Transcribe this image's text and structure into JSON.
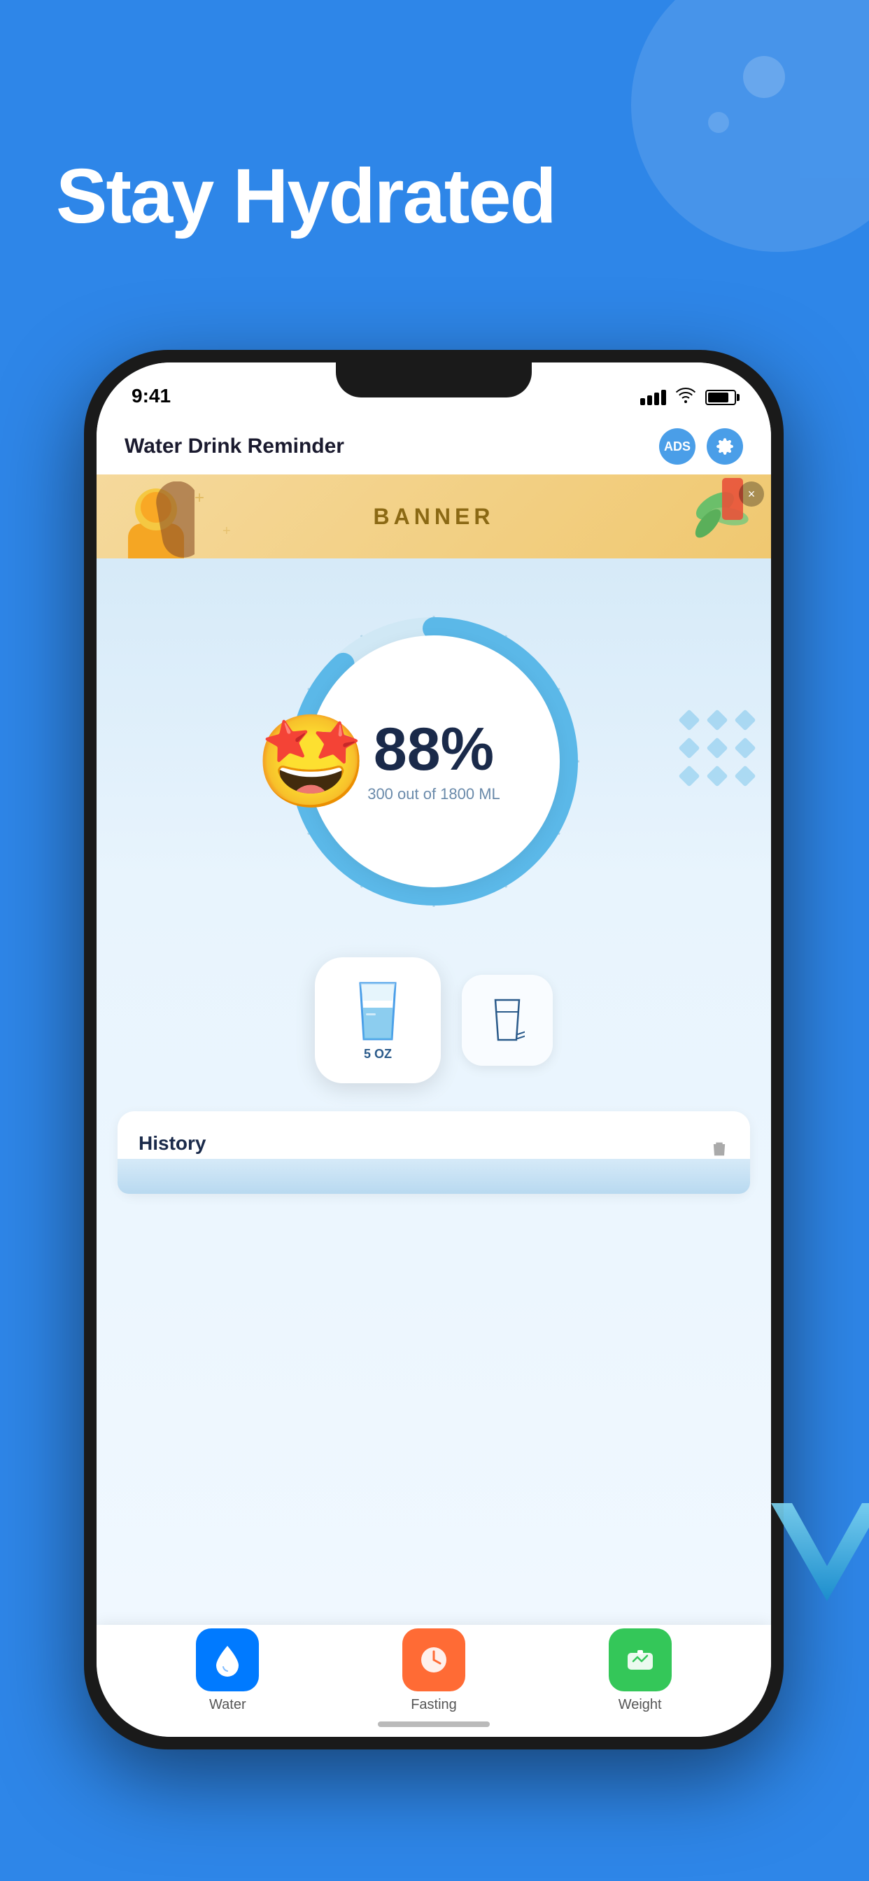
{
  "background": {
    "color": "#2E86E8"
  },
  "hero": {
    "title": "Stay Hydrated"
  },
  "status_bar": {
    "time": "9:41",
    "signal": "signal",
    "wifi": "wifi",
    "battery": "battery"
  },
  "app_header": {
    "title": "Water Drink Reminder",
    "ads_label": "ADS",
    "settings_label": "⚙"
  },
  "banner": {
    "text": "BANNER",
    "close": "×"
  },
  "progress": {
    "percent": "88%",
    "detail": "300 out of 1800 ML",
    "value": 88
  },
  "drink_buttons": {
    "primary_oz": "5\nOZ",
    "secondary_icon": "custom"
  },
  "history": {
    "title": "History"
  },
  "tab_bar": {
    "tabs": [
      {
        "label": "Water",
        "icon": "water-drop",
        "active": true
      },
      {
        "label": "Fasting",
        "icon": "clock",
        "active": false
      },
      {
        "label": "Weight",
        "icon": "scale",
        "active": false
      }
    ]
  },
  "decorations": {
    "emoji": "🤩",
    "diamonds": 9
  }
}
